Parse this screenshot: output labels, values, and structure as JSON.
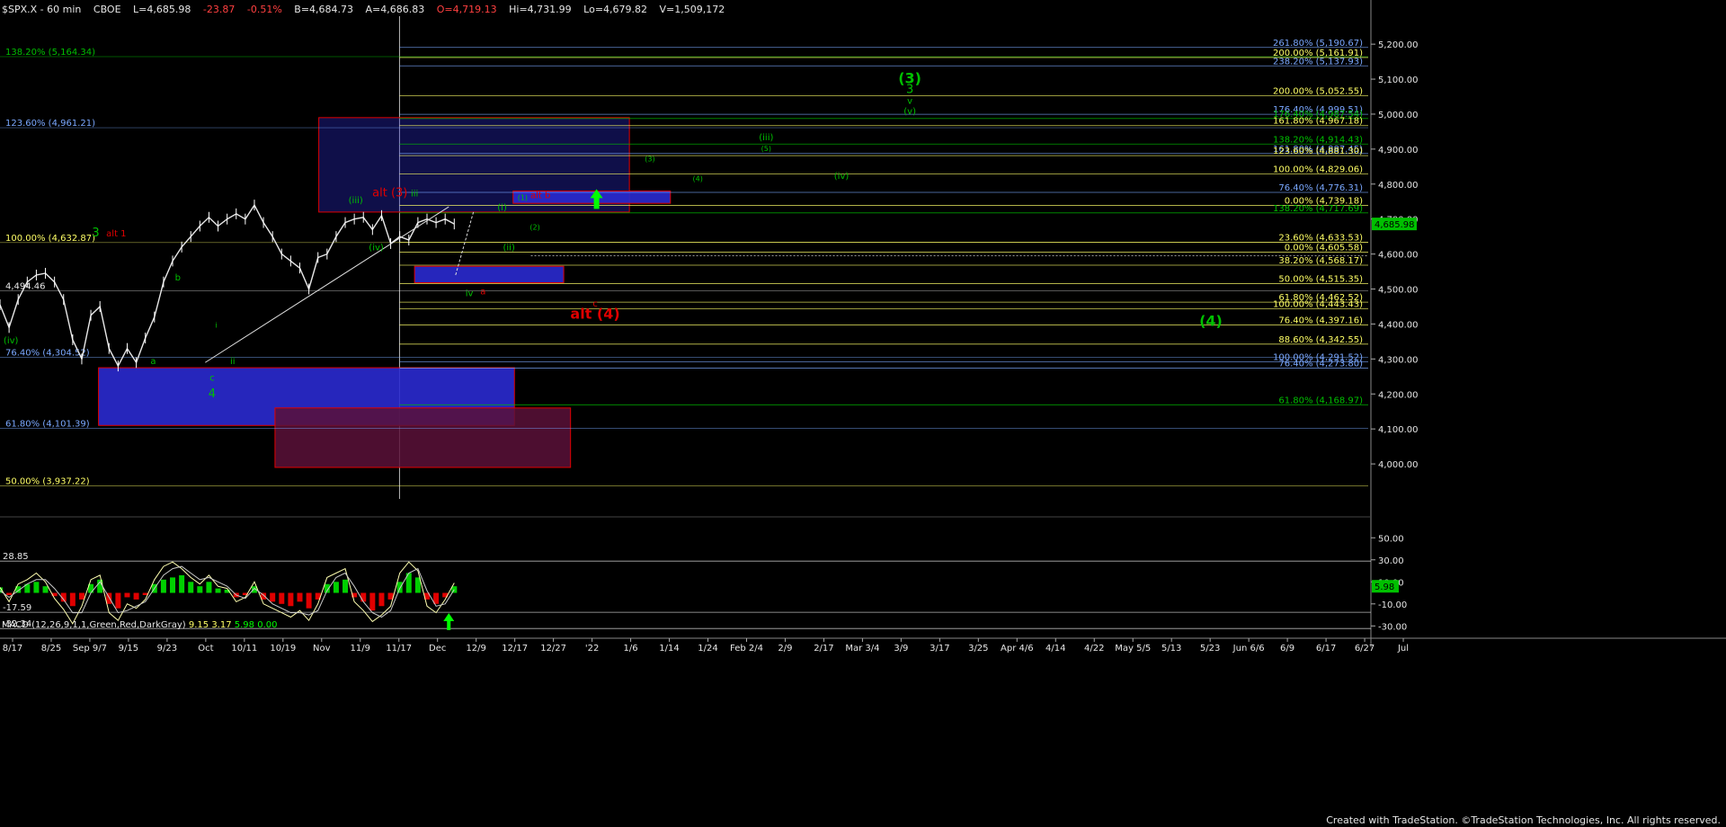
{
  "header": {
    "symbol": "$SPX.X - 60 min",
    "exchange": "CBOE",
    "last": "L=4,685.98",
    "change": "-23.87",
    "change_pct": "-0.51%",
    "bid": "B=4,684.73",
    "ask": "A=4,686.83",
    "open": "O=4,719.13",
    "high": "Hi=4,731.99",
    "low": "Lo=4,679.82",
    "volume": "V=1,509,172"
  },
  "colors": {
    "green": "#00c000",
    "red": "#e00000",
    "blue": "#2a2ad0",
    "maroon": "#5a1038",
    "yellow": "#ffff66",
    "lightblue": "#7aa8ff"
  },
  "chart_data": [
    {
      "type": "line",
      "title": "$SPX.X - 60 min",
      "ylim": [
        3900,
        5280
      ],
      "y_ticks": [
        "5,200.00",
        "5,100.00",
        "5,000.00",
        "4,900.00",
        "4,800.00",
        "4,700.00",
        "4,600.00",
        "4,500.00",
        "4,400.00",
        "4,300.00",
        "4,200.00",
        "4,100.00",
        "4,000.00"
      ],
      "last_price": "4,685.98",
      "x_ticks": [
        "8/17",
        "8/25",
        "Sep 9/7",
        "9/15",
        "9/23",
        "Oct",
        "10/11",
        "10/19",
        "Nov",
        "11/9",
        "11/17",
        "Dec",
        "12/9",
        "12/17",
        "12/27",
        "'22",
        "1/6",
        "1/14",
        "1/24",
        "Feb 2/4",
        "2/9",
        "2/17",
        "Mar 3/4",
        "3/9",
        "3/17",
        "3/25",
        "Apr 4/6",
        "4/14",
        "4/22",
        "May 5/5",
        "5/13",
        "5/23",
        "Jun 6/6",
        "6/9",
        "6/17",
        "6/27",
        "Jul"
      ],
      "price_series": {
        "x": [
          0,
          2,
          4,
          6,
          8,
          10,
          12,
          14,
          16,
          18,
          20,
          22,
          24,
          26,
          28,
          30,
          32,
          34,
          36,
          38,
          40,
          42,
          44,
          46,
          48,
          50,
          52,
          54,
          56,
          58,
          60,
          62,
          64,
          66,
          68,
          70,
          72,
          74,
          76,
          78,
          80,
          82,
          84,
          86,
          88,
          90,
          92,
          94,
          96,
          98,
          100
        ],
        "y": [
          4455,
          4390,
          4470,
          4520,
          4540,
          4545,
          4520,
          4470,
          4355,
          4300,
          4425,
          4450,
          4330,
          4280,
          4330,
          4290,
          4360,
          4420,
          4520,
          4580,
          4620,
          4650,
          4680,
          4705,
          4680,
          4700,
          4715,
          4700,
          4740,
          4690,
          4650,
          4600,
          4580,
          4560,
          4500,
          4590,
          4600,
          4650,
          4690,
          4700,
          4705,
          4670,
          4710,
          4630,
          4650,
          4640,
          4690,
          4700,
          4690,
          4700,
          4686
        ]
      },
      "fib_levels_right": [
        {
          "label": "261.80% (5,190.67)",
          "y": 5190.67,
          "color": "#7aa8ff"
        },
        {
          "label": "200.00% (5,161.91)",
          "y": 5161.91,
          "color": "#ffff66"
        },
        {
          "label": "238.20% (5,137.93)",
          "y": 5137.93,
          "color": "#7aa8ff"
        },
        {
          "label": "200.00% (5,052.55)",
          "y": 5052.55,
          "color": "#ffff66"
        },
        {
          "label": "176.40% (4,999.51)",
          "y": 4999.51,
          "color": "#7aa8ff"
        },
        {
          "label": "176.40% (4,987.54)",
          "y": 4987.54,
          "color": "#00c000"
        },
        {
          "label": "161.80% (4,967.18)",
          "y": 4967.18,
          "color": "#ffff66"
        },
        {
          "label": "138.20% (4,914.43)",
          "y": 4914.43,
          "color": "#00c000"
        },
        {
          "label": "161.80% (4,887.45)",
          "y": 4887.45,
          "color": "#7aa8ff"
        },
        {
          "label": "123.60% (4,881.30)",
          "y": 4881.3,
          "color": "#ffff66"
        },
        {
          "label": "100.00% (4,829.06)",
          "y": 4829.06,
          "color": "#ffff66"
        },
        {
          "label": "76.40% (4,776.31)",
          "y": 4776.31,
          "color": "#7aa8ff"
        },
        {
          "label": "0.00% (4,739.18)",
          "y": 4739.18,
          "color": "#ffff66"
        },
        {
          "label": "138.20% (4,717.69)",
          "y": 4717.69,
          "color": "#00c000"
        },
        {
          "label": "23.60% (4,633.53)",
          "y": 4633.53,
          "color": "#ffff66"
        },
        {
          "label": "0.00% (4,605.58)",
          "y": 4605.58,
          "color": "#ffff66"
        },
        {
          "label": "38.20% (4,568.17)",
          "y": 4568.17,
          "color": "#ffff66"
        },
        {
          "label": "50.00% (4,515.35)",
          "y": 4515.35,
          "color": "#ffff66"
        },
        {
          "label": "61.80% (4,462.52)",
          "y": 4462.52,
          "color": "#ffff66"
        },
        {
          "label": "100.00% (4,443.43)",
          "y": 4443.43,
          "color": "#ffff66"
        },
        {
          "label": "76.40% (4,397.16)",
          "y": 4397.16,
          "color": "#ffff66"
        },
        {
          "label": "88.60% (4,342.55)",
          "y": 4342.55,
          "color": "#ffff66"
        },
        {
          "label": "100.00% (4,291.52)",
          "y": 4291.52,
          "color": "#7aa8ff"
        },
        {
          "label": "76.40% (4,273.80)",
          "y": 4273.8,
          "color": "#7aa8ff"
        },
        {
          "label": "61.80% (4,168.97)",
          "y": 4168.97,
          "color": "#00c000"
        }
      ],
      "fib_levels_left": [
        {
          "label": "138.20% (5,164.34)",
          "y": 5164.34,
          "color": "#00c000"
        },
        {
          "label": "123.60% (4,961.21)",
          "y": 4961.21,
          "color": "#7aa8ff"
        },
        {
          "label": "100.00% (4,632.87)",
          "y": 4632.87,
          "color": "#ffff66"
        },
        {
          "label": "4,494.46",
          "y": 4494.46,
          "color": "#e6e6e6"
        },
        {
          "label": "76.40% (4,304.52)",
          "y": 4304.52,
          "color": "#7aa8ff"
        },
        {
          "label": "61.80% (4,101.39)",
          "y": 4101.39,
          "color": "#7aa8ff"
        },
        {
          "label": "50.00% (3,937.22)",
          "y": 3937.22,
          "color": "#ffff66"
        }
      ],
      "wave_labels": [
        {
          "text": "(3)",
          "x": 66.5,
          "y": 5088,
          "color": "#00c000",
          "size": "large"
        },
        {
          "text": "3",
          "x": 66.5,
          "y": 5060,
          "color": "#00c000",
          "size": "medium"
        },
        {
          "text": "v",
          "x": 66.5,
          "y": 5030,
          "color": "#00c000",
          "size": "small"
        },
        {
          "text": "(v)",
          "x": 66.5,
          "y": 5000,
          "color": "#00c000",
          "size": "small"
        },
        {
          "text": "(iii)",
          "x": 56,
          "y": 4925,
          "color": "#00c000",
          "size": "small"
        },
        {
          "text": "(5)",
          "x": 56,
          "y": 4895,
          "color": "#00c000",
          "size": "tiny"
        },
        {
          "text": "(3)",
          "x": 47.5,
          "y": 4865,
          "color": "#00c000",
          "size": "tiny"
        },
        {
          "text": "(iv)",
          "x": 61.5,
          "y": 4815,
          "color": "#00c000",
          "size": "small"
        },
        {
          "text": "(4)",
          "x": 51,
          "y": 4808,
          "color": "#00c000",
          "size": "tiny"
        },
        {
          "text": "alt (3)",
          "x": 28.5,
          "y": 4765,
          "color": "#e00000",
          "size": "medium"
        },
        {
          "text": "(iii)",
          "x": 26,
          "y": 4745,
          "color": "#00c000",
          "size": "small"
        },
        {
          "text": "iii",
          "x": 30.3,
          "y": 4765,
          "color": "#00c000",
          "size": "small"
        },
        {
          "text": "alt b",
          "x": 39.5,
          "y": 4760,
          "color": "#e00000",
          "size": "small"
        },
        {
          "text": "(1)",
          "x": 38.2,
          "y": 4755,
          "color": "#00c000",
          "size": "tiny"
        },
        {
          "text": "(i)",
          "x": 36.7,
          "y": 4725,
          "color": "#00c000",
          "size": "small"
        },
        {
          "text": "(2)",
          "x": 39.1,
          "y": 4670,
          "color": "#00c000",
          "size": "tiny"
        },
        {
          "text": "(ii)",
          "x": 37.2,
          "y": 4610,
          "color": "#00c000",
          "size": "small"
        },
        {
          "text": "(iv)",
          "x": 27.5,
          "y": 4610,
          "color": "#00c000",
          "size": "small"
        },
        {
          "text": "3",
          "x": 7,
          "y": 4650,
          "color": "#00c000",
          "size": "medium"
        },
        {
          "text": "alt 1",
          "x": 8.5,
          "y": 4650,
          "color": "#e00000",
          "size": "small"
        },
        {
          "text": "b",
          "x": 13,
          "y": 4525,
          "color": "#00c000",
          "size": "small"
        },
        {
          "text": "iv",
          "x": 34.3,
          "y": 4480,
          "color": "#00c000",
          "size": "small"
        },
        {
          "text": "a",
          "x": 35.3,
          "y": 4485,
          "color": "#e00000",
          "size": "small"
        },
        {
          "text": "c",
          "x": 43.5,
          "y": 4450,
          "color": "#e00000",
          "size": "small"
        },
        {
          "text": "alt (4)",
          "x": 43.5,
          "y": 4415,
          "color": "#e00000",
          "size": "large"
        },
        {
          "text": "(4)",
          "x": 88.5,
          "y": 4395,
          "color": "#00c000",
          "size": "large"
        },
        {
          "text": "(iv)",
          "x": 0.8,
          "y": 4345,
          "color": "#00c000",
          "size": "small"
        },
        {
          "text": "a",
          "x": 11.2,
          "y": 4285,
          "color": "#00c000",
          "size": "small"
        },
        {
          "text": "i",
          "x": 15.8,
          "y": 4390,
          "color": "#00c000",
          "size": "tiny"
        },
        {
          "text": "ii",
          "x": 17,
          "y": 4285,
          "color": "#00c000",
          "size": "small"
        },
        {
          "text": "c",
          "x": 15.5,
          "y": 4238,
          "color": "#00c000",
          "size": "small"
        },
        {
          "text": "4",
          "x": 15.5,
          "y": 4190,
          "color": "#00c000",
          "size": "medium"
        }
      ],
      "zones": [
        {
          "name": "blue-zone-top",
          "x1": 23.3,
          "x2": 46,
          "y1": 4990,
          "y2": 4720,
          "fill": "#2a2ad0",
          "alpha": 0.35,
          "border": "#e00000"
        },
        {
          "name": "blue-zone-alt-b",
          "x1": 37.5,
          "x2": 49,
          "y1": 4780,
          "y2": 4745,
          "fill": "#2a2ad0",
          "alpha": 0.9,
          "border": "#e00000"
        },
        {
          "name": "blue-zone-mid",
          "x1": 30.3,
          "x2": 41.2,
          "y1": 4565,
          "y2": 4518,
          "fill": "#2a2ad0",
          "alpha": 0.9,
          "border": "#e00000"
        },
        {
          "name": "blue-zone-bottom",
          "x1": 7.2,
          "x2": 37.6,
          "y1": 4275,
          "y2": 4110,
          "fill": "#2a2ad0",
          "alpha": 0.9,
          "border": "#e00000"
        },
        {
          "name": "maroon-zone-bottom",
          "x1": 20.1,
          "x2": 41.7,
          "y1": 4160,
          "y2": 3990,
          "fill": "#5a1038",
          "alpha": 0.85,
          "border": "#e00000"
        }
      ],
      "arrows": [
        {
          "x": 43.6,
          "y": 4765,
          "dir": "up",
          "color": "#00ff00"
        }
      ]
    },
    {
      "type": "area",
      "title": "MACD (12,26,9,1,1,Green,Red,DarkGray)",
      "legend_values": [
        "9.15",
        "3.17",
        "5.98",
        "0.00"
      ],
      "ylim": [
        -33,
        60
      ],
      "y_ticks": [
        "50.00",
        "30.00",
        "10.00",
        "-10.00",
        "-30.00"
      ],
      "left_labels": [
        "28.85",
        "-17.59",
        "-32.34"
      ],
      "last_value": "5.98",
      "histogram": {
        "x": [
          0,
          2,
          4,
          6,
          8,
          10,
          12,
          14,
          16,
          18,
          20,
          22,
          24,
          26,
          28,
          30,
          32,
          34,
          36,
          38,
          40,
          42,
          44,
          46,
          48,
          50,
          52,
          54,
          56,
          58,
          60,
          62,
          64,
          66,
          68,
          70,
          72,
          74,
          76,
          78,
          80,
          82,
          84,
          86,
          88,
          90,
          92,
          94,
          96,
          98,
          100
        ],
        "y": [
          5,
          -2,
          6,
          8,
          10,
          6,
          -3,
          -8,
          -12,
          -6,
          8,
          12,
          -10,
          -14,
          -4,
          -6,
          -2,
          8,
          12,
          14,
          16,
          10,
          6,
          10,
          4,
          3,
          -4,
          -2,
          6,
          -6,
          -8,
          -10,
          -12,
          -8,
          -14,
          -6,
          8,
          10,
          12,
          -4,
          -8,
          -16,
          -12,
          -6,
          10,
          18,
          14,
          -6,
          -10,
          -4,
          6
        ]
      },
      "macd_line": {
        "x": [
          0,
          2,
          4,
          6,
          8,
          10,
          12,
          14,
          16,
          18,
          20,
          22,
          24,
          26,
          28,
          30,
          32,
          34,
          36,
          38,
          40,
          42,
          44,
          46,
          48,
          50,
          52,
          54,
          56,
          58,
          60,
          62,
          64,
          66,
          68,
          70,
          72,
          74,
          76,
          78,
          80,
          82,
          84,
          86,
          88,
          90,
          92,
          94,
          96,
          98,
          100
        ],
        "y": [
          5,
          -8,
          8,
          12,
          18,
          10,
          -5,
          -15,
          -28,
          -12,
          12,
          16,
          -18,
          -25,
          -10,
          -14,
          -6,
          12,
          24,
          28,
          22,
          14,
          8,
          16,
          6,
          4,
          -8,
          -4,
          10,
          -10,
          -14,
          -18,
          -22,
          -16,
          -25,
          -10,
          14,
          18,
          22,
          -8,
          -16,
          -26,
          -20,
          -12,
          18,
          28,
          20,
          -12,
          -18,
          -6,
          9
        ]
      },
      "signal_line": {
        "x": [
          0,
          2,
          4,
          6,
          8,
          10,
          12,
          14,
          16,
          18,
          20,
          22,
          24,
          26,
          28,
          30,
          32,
          34,
          36,
          38,
          40,
          42,
          44,
          46,
          48,
          50,
          52,
          54,
          56,
          58,
          60,
          62,
          64,
          66,
          68,
          70,
          72,
          74,
          76,
          78,
          80,
          82,
          84,
          86,
          88,
          90,
          92,
          94,
          96,
          98,
          100
        ],
        "y": [
          2,
          -4,
          2,
          8,
          12,
          12,
          4,
          -6,
          -18,
          -18,
          0,
          10,
          -4,
          -18,
          -16,
          -12,
          -8,
          4,
          16,
          22,
          24,
          18,
          12,
          14,
          10,
          6,
          -2,
          -5,
          4,
          -2,
          -10,
          -14,
          -18,
          -18,
          -20,
          -16,
          2,
          14,
          18,
          6,
          -8,
          -18,
          -22,
          -16,
          4,
          18,
          22,
          2,
          -12,
          -10,
          3
        ]
      }
    }
  ],
  "footer": "Created with TradeStation. ©TradeStation Technologies, Inc. All rights reserved."
}
